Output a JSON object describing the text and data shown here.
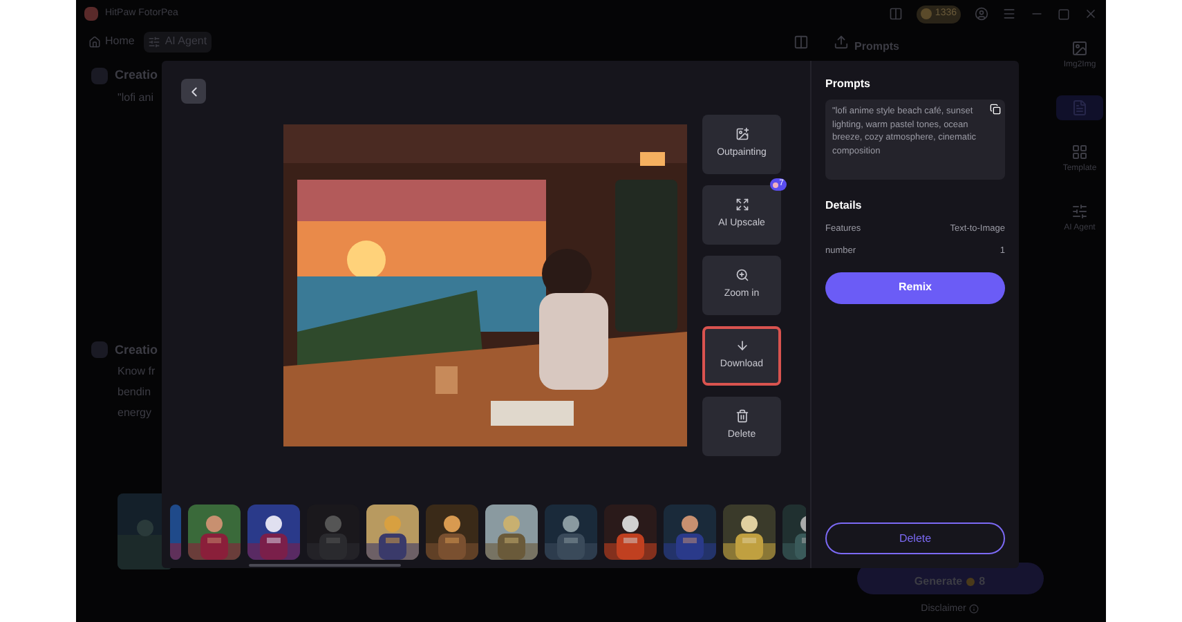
{
  "app": {
    "title": "HitPaw FotorPea",
    "coins": "1336"
  },
  "nav": [
    {
      "label": "Home",
      "selected": false
    },
    {
      "label": "AI Agent",
      "selected": true
    }
  ],
  "background": {
    "cards": [
      {
        "title": "Creatio",
        "lines": [
          "\"lofi ani"
        ]
      },
      {
        "title": "Creatio",
        "lines": [
          "Know fr",
          "bendin",
          "energy"
        ]
      }
    ],
    "panel_title": "Prompts",
    "sidebar": [
      {
        "label": "Img2Img",
        "selected": false
      },
      {
        "selected": true
      },
      {
        "label": "Template",
        "selected": false
      },
      {
        "label": "AI Agent",
        "selected": false
      }
    ],
    "generate": {
      "label": "Generate",
      "cost": "8"
    },
    "disclaimer": "Disclaimer"
  },
  "viewer": {
    "tools": [
      {
        "label": "Outpainting",
        "selected": false
      },
      {
        "label": "AI Upscale",
        "selected": false,
        "badge": "7"
      },
      {
        "label": "Zoom in",
        "selected": false
      },
      {
        "label": "Download",
        "selected": true
      },
      {
        "label": "Delete",
        "selected": false
      }
    ]
  },
  "details_panel": {
    "prompts_title": "Prompts",
    "prompt": "\"lofi anime style beach café, sunset lighting, warm pastel tones, ocean breeze, cozy atmosphere, cinematic composition",
    "details_title": "Details",
    "rows": [
      {
        "label": "Features",
        "value": "Text-to-Image"
      },
      {
        "label": "number",
        "value": "1"
      }
    ],
    "remix": "Remix",
    "delete": "Delete"
  }
}
